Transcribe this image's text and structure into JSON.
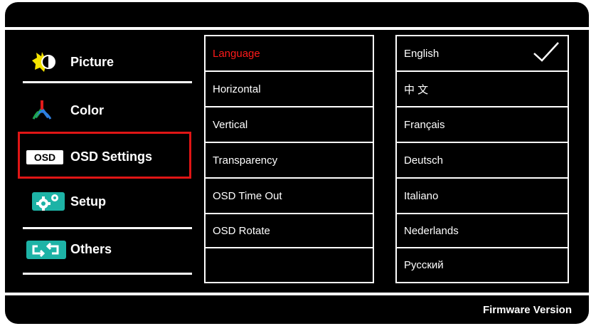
{
  "menu": {
    "items": [
      {
        "label": "Picture",
        "icon": "sun-contrast-icon"
      },
      {
        "label": "Color",
        "icon": "rgb-color-icon"
      },
      {
        "label": "OSD Settings",
        "icon": "osd-badge-icon",
        "badge": "OSD",
        "selected": true
      },
      {
        "label": "Setup",
        "icon": "gears-icon"
      },
      {
        "label": "Others",
        "icon": "loop-arrows-icon"
      }
    ]
  },
  "settings": {
    "items": [
      "Language",
      "Horizontal",
      "Vertical",
      "Transparency",
      "OSD Time Out",
      "OSD Rotate",
      ""
    ],
    "active": "Language"
  },
  "languages": {
    "items": [
      "English",
      "中 文",
      "Français",
      "Deutsch",
      "Italiano",
      "Nederlands",
      "Русский"
    ],
    "selected": "English"
  },
  "footer": {
    "firmware_label": "Firmware Version"
  },
  "colors": {
    "accent_red": "#e01515",
    "background": "#000000",
    "accent_teal": "#1db3a6"
  }
}
